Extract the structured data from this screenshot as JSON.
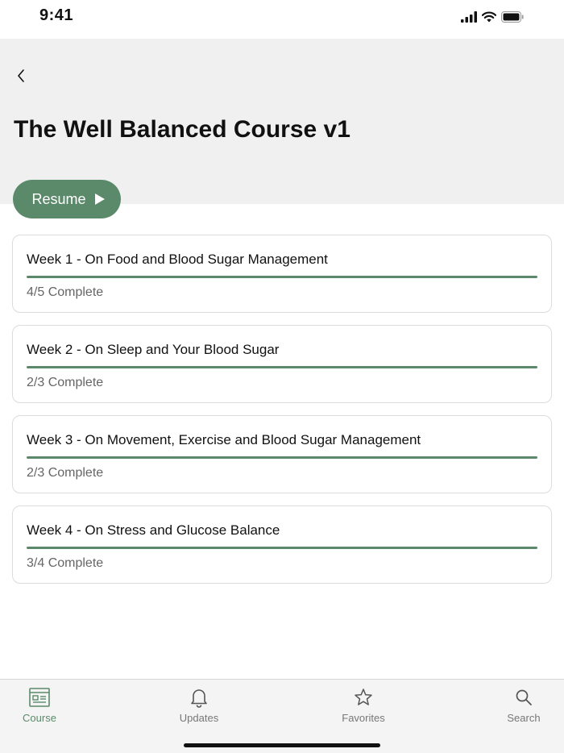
{
  "status_bar": {
    "time": "9:41"
  },
  "header": {
    "title": "The Well Balanced Course v1",
    "resume_label": "Resume"
  },
  "weeks": [
    {
      "title": "Week 1 - On Food and Blood Sugar Management",
      "status": "4/5 Complete",
      "progress": 1.0
    },
    {
      "title": "Week 2 - On Sleep and Your Blood Sugar",
      "status": "2/3 Complete",
      "progress": 1.0
    },
    {
      "title": "Week 3 - On Movement, Exercise and Blood Sugar Management",
      "status": "2/3 Complete",
      "progress": 1.0
    },
    {
      "title": "Week 4 - On Stress and Glucose Balance",
      "status": "3/4 Complete",
      "progress": 1.0
    }
  ],
  "tab_bar": {
    "tabs": [
      {
        "label": "Course",
        "icon": "course-icon",
        "active": true
      },
      {
        "label": "Updates",
        "icon": "bell-icon",
        "active": false
      },
      {
        "label": "Favorites",
        "icon": "star-icon",
        "active": false
      },
      {
        "label": "Search",
        "icon": "search-icon",
        "active": false
      }
    ]
  },
  "colors": {
    "accent": "#5a8a6a",
    "header_bg": "#f0f0f0",
    "tab_bar_bg": "#f4f4f4"
  }
}
